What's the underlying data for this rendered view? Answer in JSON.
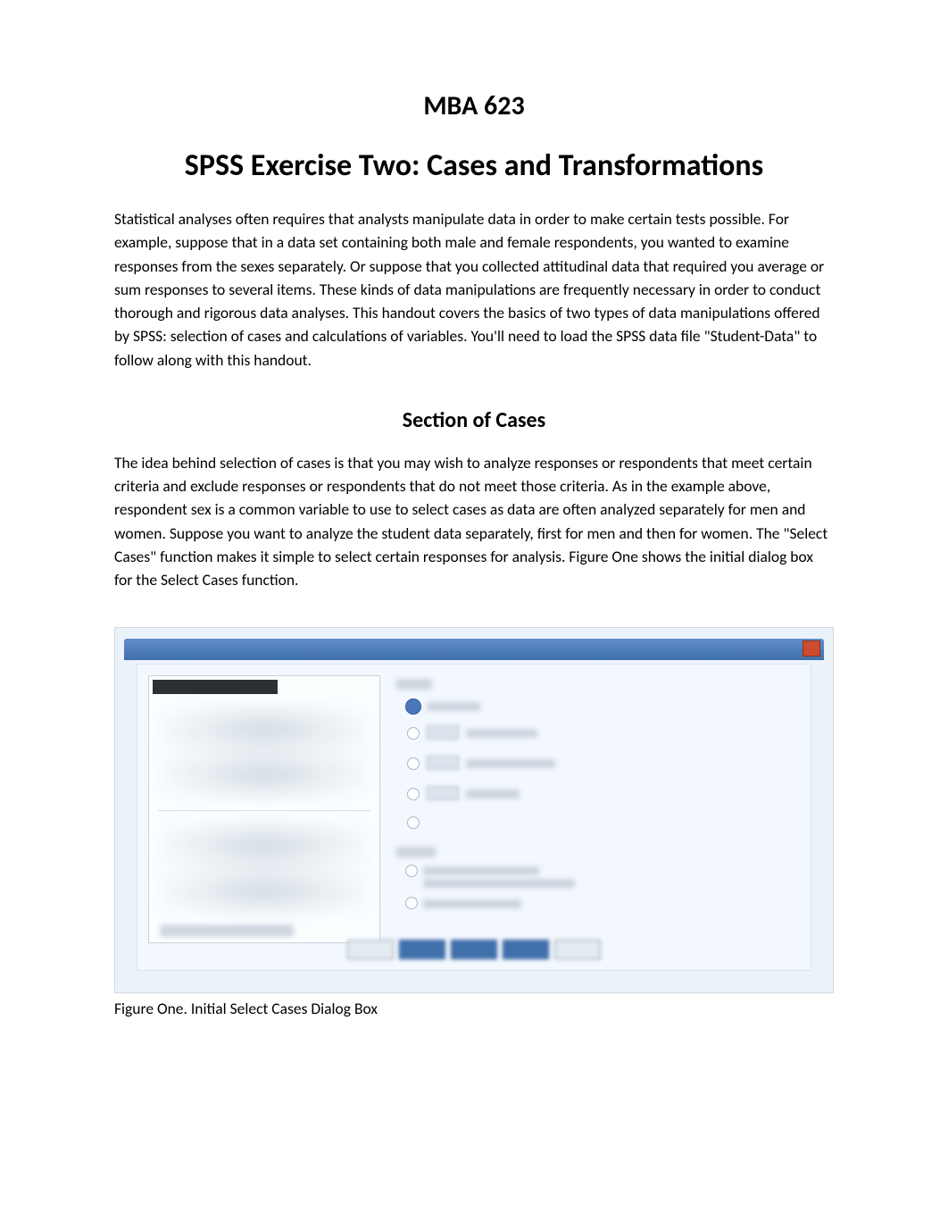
{
  "header": {
    "course": "MBA 623",
    "title": "SPSS Exercise Two: Cases and Transformations"
  },
  "intro": {
    "paragraph": "Statistical analyses often requires that analysts manipulate data in order to make certain tests possible. For example, suppose that in a data set containing both male and female respondents, you wanted to examine responses from the sexes separately.  Or suppose that you collected attitudinal data that required you average or sum responses to several items.  These kinds of data manipulations are frequently necessary in order to conduct thorough and rigorous data analyses.   This handout covers the basics of two types of data manipulations offered by SPSS:  selection of cases and calculations of variables.  You'll need to load the SPSS data file \"Student-Data\" to follow along with this handout."
  },
  "section1": {
    "heading": "Section of Cases",
    "paragraph": "The idea behind selection of cases is that you may wish to analyze responses or respondents that meet certain criteria and exclude responses or respondents that do not meet those criteria.   As in the example above, respondent sex is a common variable to use to select cases as data are often analyzed separately for men and women.    Suppose you want to analyze the student data separately, first for men and then for women.  The \"Select Cases\" function makes it simple to select certain responses for analysis.  Figure One shows the initial dialog box for the Select Cases function."
  },
  "figure1": {
    "caption": "Figure One.   Initial Select Cases Dialog Box"
  }
}
